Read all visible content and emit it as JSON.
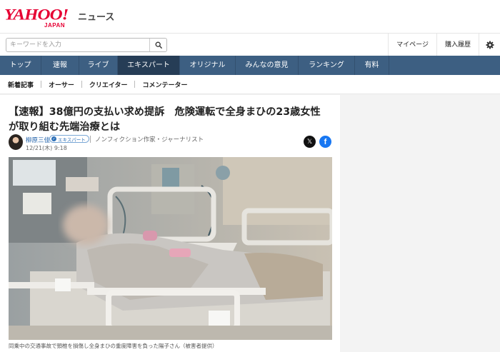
{
  "header": {
    "logo_yahoo": "YAHOO!",
    "logo_japan": "JAPAN",
    "logo_news": "ニュース"
  },
  "search": {
    "placeholder": "キーワードを入力",
    "icon": "search-icon"
  },
  "utility_links": [
    "マイページ",
    "購入履歴"
  ],
  "settings_icon": "gear-icon",
  "nav": {
    "items": [
      "トップ",
      "速報",
      "ライブ",
      "エキスパート",
      "オリジナル",
      "みんなの意見",
      "ランキング",
      "有料"
    ],
    "active": "エキスパート",
    "colors": {
      "bar": "#3d5f82",
      "active": "#263d56"
    }
  },
  "subnav": {
    "items": [
      "新着記事",
      "オーサー",
      "クリエイター",
      "コメンテーター"
    ]
  },
  "article": {
    "title": "【速報】38億円の支払い求め提訴　危険運転で全身まひの23歳女性が取り組む先端治療とは",
    "author_name": "柳原三佳",
    "badge": "エキスパート",
    "author_role": "ノンフィクション作家・ジャーナリスト",
    "date": "12/21(木) 9:18",
    "share": {
      "x_icon": "x-logo-icon",
      "facebook_icon": "facebook-icon",
      "x_glyph": "𝕏",
      "facebook_glyph": "f"
    },
    "photo_caption": "同乗中の交通事故で頸椎を損傷し全身まひの重度障害を負った陽子さん（被害者提供）"
  },
  "colors": {
    "brand_red": "#e60033",
    "link_blue": "#1d5fa8",
    "facebook_blue": "#1877f2"
  }
}
